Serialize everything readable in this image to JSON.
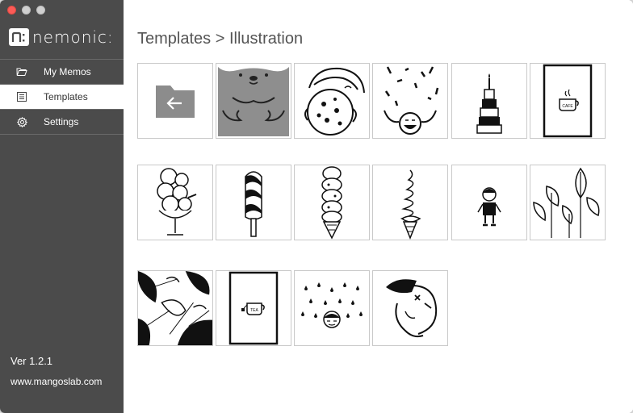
{
  "app": {
    "logo_text": "nemonic:",
    "logo_mark": "n:"
  },
  "sidebar": {
    "items": [
      {
        "label": "My Memos",
        "icon": "folder-icon"
      },
      {
        "label": "Templates",
        "icon": "list-icon",
        "active": true
      },
      {
        "label": "Settings",
        "icon": "gear-icon"
      }
    ],
    "version": "Ver 1.2.1",
    "website": "www.mangoslab.com"
  },
  "main": {
    "breadcrumb": "Templates > Illustration",
    "templates": [
      {
        "name": "back-folder"
      },
      {
        "name": "bear"
      },
      {
        "name": "girl-cookie"
      },
      {
        "name": "confetti-face"
      },
      {
        "name": "birthday-cake"
      },
      {
        "name": "coffee-cup"
      },
      {
        "name": "ice-cream-sundae"
      },
      {
        "name": "popsicle"
      },
      {
        "name": "ice-cream-cone"
      },
      {
        "name": "soft-serve"
      },
      {
        "name": "boy"
      },
      {
        "name": "leaves"
      },
      {
        "name": "tropical-pattern"
      },
      {
        "name": "tea-cup"
      },
      {
        "name": "rain-face"
      },
      {
        "name": "angry-face"
      }
    ],
    "cup_label_coffee": "CAFE",
    "cup_label_tea": "TEA"
  },
  "colors": {
    "sidebar_bg": "#4b4b4b",
    "active_bg": "#ffffff",
    "tile_border": "#c9c9c9",
    "close_button": "#fc5b57"
  }
}
